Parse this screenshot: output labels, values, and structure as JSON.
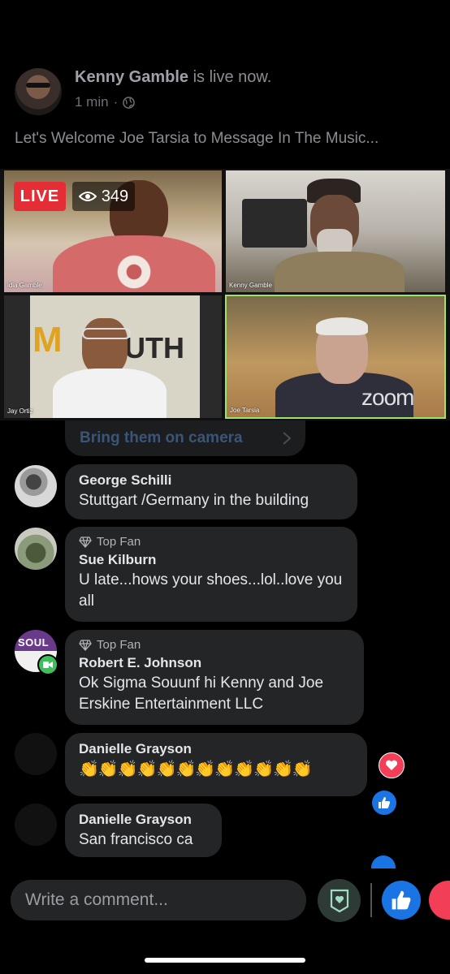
{
  "post": {
    "host_name": "Kenny Gamble",
    "live_status": " is live now.",
    "time_ago": "1 min",
    "separator": "·",
    "caption": "Let's Welcome Joe Tarsia to Message In The Music..."
  },
  "video": {
    "live_label": "LIVE",
    "viewer_count": "349",
    "participants": [
      "idia Gamble",
      "Kenny Gamble",
      "Jay Ortiz",
      "Joe Tarsia"
    ],
    "brand_logo": "zoom",
    "sign_text": "UTH"
  },
  "bring_on_camera": {
    "label": "Bring them on camera"
  },
  "comments": [
    {
      "name": "George Schilli",
      "badge": "",
      "text": "Stuttgart /Germany in the building"
    },
    {
      "name": "Sue Kilburn",
      "badge": "Top Fan",
      "text": "U late...hows your shoes...lol..love you all"
    },
    {
      "name": "Robert E. Johnson",
      "badge": "Top Fan",
      "text": "Ok Sigma Souunf hi Kenny and Joe Erskine Entertainment LLC",
      "avatar_text": "SOUL"
    },
    {
      "name": "Danielle Grayson",
      "badge": "",
      "text": "👏👏👏👏👏👏👏👏👏👏👏👏"
    },
    {
      "name": "Danielle Grayson",
      "badge": "",
      "text": "San francisco ca"
    }
  ],
  "composer": {
    "placeholder": "Write a comment..."
  },
  "colors": {
    "live_red": "#e42d35",
    "like_blue": "#1b74e4",
    "love_red": "#f33e58",
    "zoom_border": "#9fe26b"
  },
  "icons": [
    "globe-icon",
    "eye-icon",
    "chevron-right-icon",
    "diamond-icon",
    "heart-icon",
    "thumbs-up-icon",
    "support-shield-icon"
  ]
}
